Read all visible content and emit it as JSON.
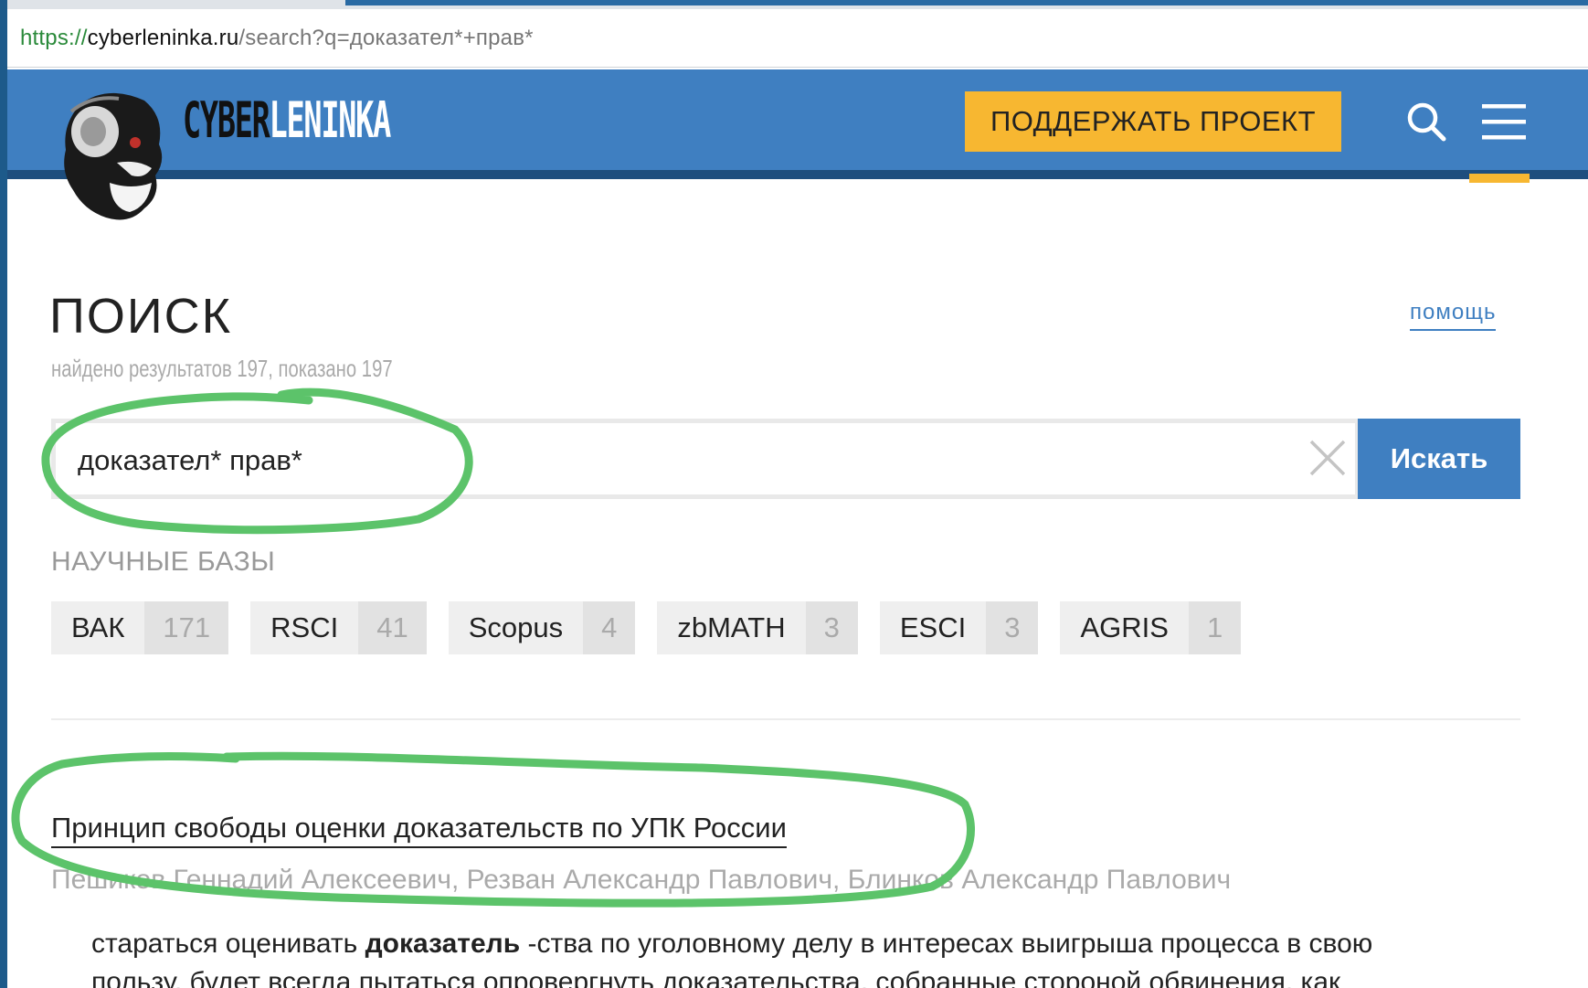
{
  "browser": {
    "url_scheme": "https://",
    "url_host": "cyberleninka.ru",
    "url_path": "/search?q=доказател*+прав*"
  },
  "header": {
    "brand_part1": "CYBER",
    "brand_part2": "LENINKA",
    "support_label": "ПОДДЕРЖАТЬ ПРОЕКТ"
  },
  "search": {
    "title": "ПОИСК",
    "help_label": "помощь",
    "results_text": "найдено результатов 197, показано 197",
    "query": "доказател* прав*",
    "button_label": "Искать"
  },
  "bases": {
    "heading": "НАУЧНЫЕ БАЗЫ",
    "items": [
      {
        "name": "ВАК",
        "count": "171"
      },
      {
        "name": "RSCI",
        "count": "41"
      },
      {
        "name": "Scopus",
        "count": "4"
      },
      {
        "name": "zbMATH",
        "count": "3"
      },
      {
        "name": "ESCI",
        "count": "3"
      },
      {
        "name": "AGRIS",
        "count": "1"
      }
    ]
  },
  "results": [
    {
      "title": "Принцип свободы оценки доказательств по УПК России",
      "authors": "Пешиков Геннадий Алексеевич, Резван Александр Павлович, Блинков Александр Павлович",
      "snippet_before": "стараться оценивать ",
      "snippet_highlight": "доказатель",
      "snippet_after": " -ства по уголовному делу в интересах выигрыша процесса в свою",
      "snippet_line2": "пользу, будет всегда пытаться опровергнуть доказательства, собранные стороной обвинения, как"
    }
  ],
  "colors": {
    "header_blue": "#3f7fc1",
    "header_dark": "#1e4e7e",
    "accent_yellow": "#f7b731",
    "annotation_green": "#5cc36a"
  },
  "icons": {
    "search": "search-icon",
    "menu": "menu-icon",
    "clear": "close-icon"
  }
}
